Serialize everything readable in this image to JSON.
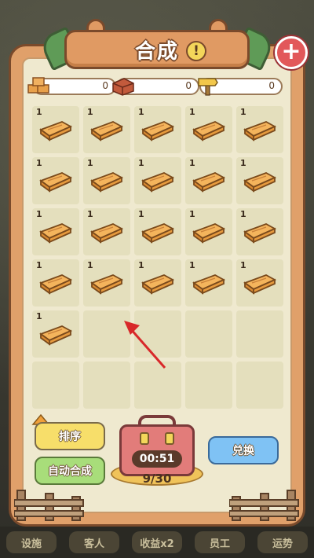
{
  "title": "合成",
  "info_symbol": "!",
  "close_symbol": "+",
  "resources": [
    {
      "icon": "wood-planks-icon",
      "value": "0"
    },
    {
      "icon": "brick-icon",
      "value": "0"
    },
    {
      "icon": "hammer-icon",
      "value": "0"
    }
  ],
  "grid": {
    "rows": 6,
    "cols": 5,
    "filled": 21,
    "item_icon": "wood-plank-icon",
    "item_level": "1"
  },
  "buttons": {
    "sort": "排序",
    "auto_merge": "自动合成",
    "exchange": "兑换"
  },
  "chest": {
    "timer": "00:51",
    "capacity": "9/30"
  },
  "bottom_nav": [
    "设施",
    "客人",
    "收益x2",
    "员工",
    "运势"
  ],
  "colors": {
    "panel": "#e0a06a",
    "panel_inner": "#efe9cf",
    "slot": "#e4dfbd",
    "wood": "#eaa049",
    "close": "#e2585a",
    "arrow": "#d8282a"
  }
}
